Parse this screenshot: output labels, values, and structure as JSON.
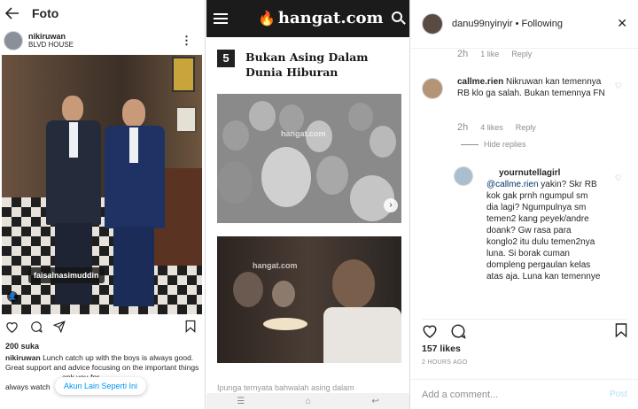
{
  "panel1": {
    "top_title": "Foto",
    "username": "nikiruwan",
    "location": "BLVD HOUSE",
    "tag_name": "faisalnasimuddin",
    "likes": "200 suka",
    "caption_user": "nikiruwan",
    "caption_text": "Lunch catch up with the boys is always good. Great support and advice focusing on the important things",
    "caption_tail1": "ank you for",
    "caption_line3": "always watch",
    "more_button": "Akun Lain Seperti Ini"
  },
  "panel2": {
    "brand": "hangat.com",
    "article_number": "5",
    "article_title": "Bukan Asing Dalam Dunia Hiburan",
    "watermark": "hangat.com",
    "faded_text": "Ipunga ternyata bahwalah asing dalam"
  },
  "panel3": {
    "header_user": "danu99nyinyir",
    "header_dot": "•",
    "header_following": "Following",
    "top_meta": {
      "time": "2h",
      "likes": "1 like",
      "reply": "Reply"
    },
    "comment1": {
      "user": "callme.rien",
      "text": "Nikruwan kan temennya RB klo ga salah. Bukan temennya FN",
      "time": "2h",
      "likes": "4 likes",
      "reply": "Reply",
      "hide": "Hide replies"
    },
    "reply1": {
      "user": "yournutellagirl",
      "mention": "@callme.rien",
      "text": "yakin? Skr RB kok gak prnh ngumpul sm dia lagi? Ngumpulnya sm temen2 kang peyek/andre doank? Gw rasa para konglo2 itu dulu temen2nya luna. Si borak cuman dompleng pergaulan kelas atas aja. Luna kan temennye"
    },
    "likes": "157 likes",
    "time_ago": "2 HOURS AGO",
    "add_placeholder": "Add a comment...",
    "post_label": "Post"
  },
  "colors": {
    "link_blue": "#0095f6",
    "post_disabled": "#b2dffc",
    "hangat_orange": "#f26b1d"
  }
}
